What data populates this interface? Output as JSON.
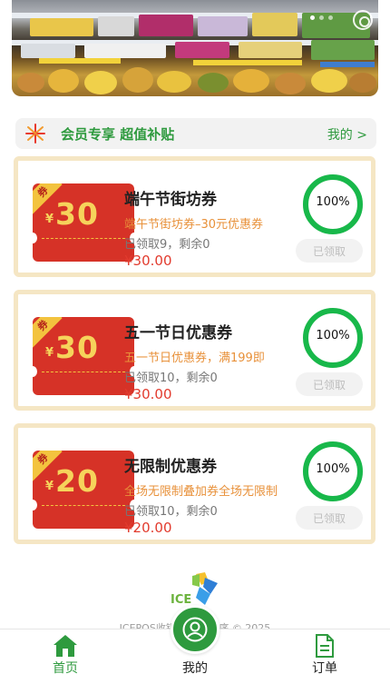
{
  "banner": {
    "dots": 3,
    "active_dot": 1
  },
  "member": {
    "title": "会员专享 超值补贴",
    "link": "我的 >"
  },
  "coupons": [
    {
      "badge": "券",
      "currency": "¥",
      "amount": "30",
      "title": "端午节街坊券",
      "desc": "端午节街坊券–30元优惠券",
      "stat": "已领取9，剩余0",
      "price": "¥30.00",
      "progress_text": "100%",
      "progress": 1.0,
      "button": "已领取"
    },
    {
      "badge": "券",
      "currency": "¥",
      "amount": "30",
      "title": "五一节日优惠券",
      "desc": "五一节日优惠券，满199即",
      "stat": "已领取10，剩余0",
      "price": "¥30.00",
      "progress_text": "100%",
      "progress": 1.0,
      "button": "已领取"
    },
    {
      "badge": "券",
      "currency": "¥",
      "amount": "20",
      "title": "无限制优惠券",
      "desc": "全场无限制叠加券全场无限制",
      "stat": "已领取10，剩余0",
      "price": "¥20.00",
      "progress_text": "100%",
      "progress": 1.0,
      "button": "已领取"
    }
  ],
  "footer": {
    "logo_text": "ICE",
    "copyright": "ICEPOS收银系统    小程序 © 2025"
  },
  "tabbar": {
    "home": "首页",
    "me": "我的",
    "order": "订单"
  },
  "colors": {
    "brand_green": "#2e9a3e",
    "coupon_red": "#d63227",
    "coupon_gold": "#f6d35b",
    "desc_orange": "#e8913a",
    "price_red": "#e23b2e"
  }
}
